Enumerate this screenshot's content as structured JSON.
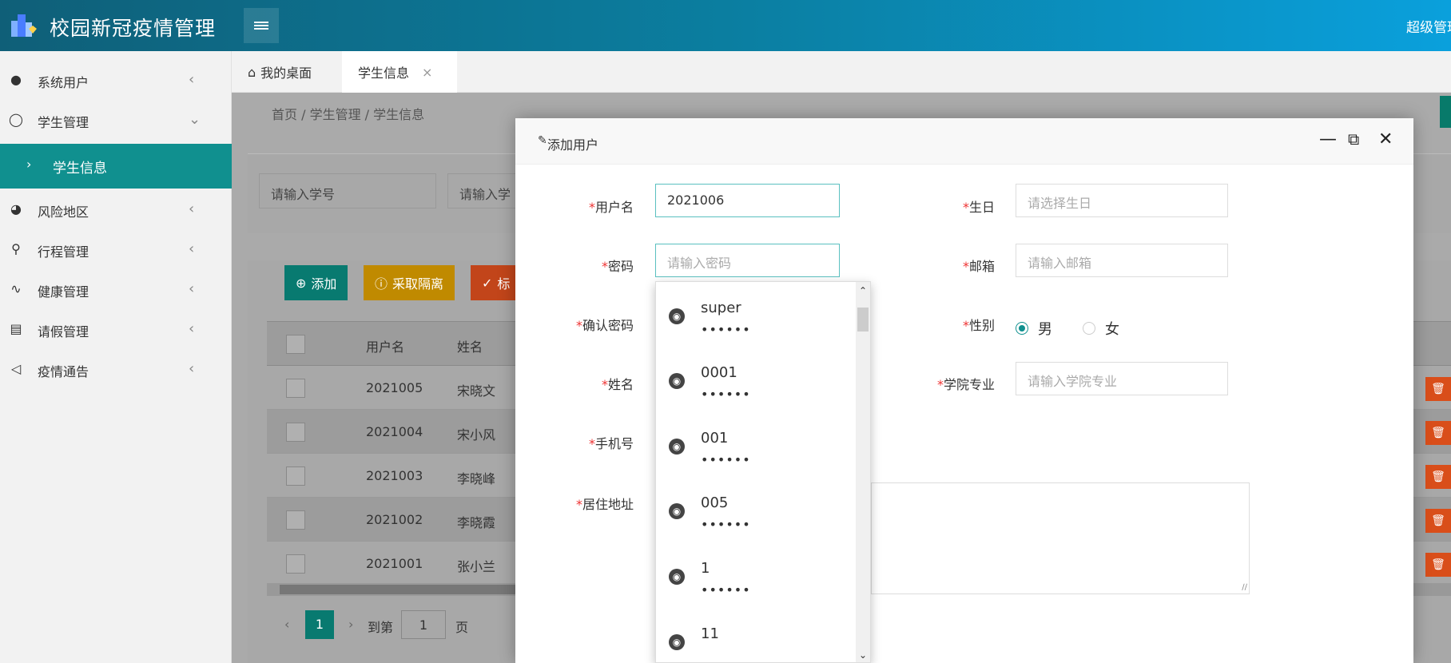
{
  "header": {
    "title": "校园新冠疫情管理",
    "admin_label": "超级管理员"
  },
  "sidebar": {
    "items": [
      {
        "label": "系统用户",
        "icon": "user-solid-icon"
      },
      {
        "label": "学生管理",
        "icon": "user-outline-icon"
      },
      {
        "label": "风险地区",
        "icon": "chart-pie-icon"
      },
      {
        "label": "行程管理",
        "icon": "location-icon"
      },
      {
        "label": "健康管理",
        "icon": "pulse-icon"
      },
      {
        "label": "请假管理",
        "icon": "document-icon"
      },
      {
        "label": "疫情通告",
        "icon": "speaker-icon"
      }
    ],
    "active_sub_item": "学生信息"
  },
  "tabs": [
    {
      "label": "我的桌面"
    },
    {
      "label": "学生信息",
      "close": "×"
    }
  ],
  "breadcrumb": {
    "text": "首页 / 学生管理 / 学生信息"
  },
  "search": {
    "student_no_placeholder": "请输入学号",
    "name_placeholder": "请输入学"
  },
  "toolbar": {
    "add_label": "添加",
    "isolate_label": "采取隔离",
    "mark_label": "标"
  },
  "table": {
    "headers": [
      "用户名",
      "姓名"
    ],
    "rows": [
      [
        "2021005",
        "宋晓文"
      ],
      [
        "2021004",
        "宋小风"
      ],
      [
        "2021003",
        "李晓峰"
      ],
      [
        "2021002",
        "李晓霞"
      ],
      [
        "2021001",
        "张小兰"
      ]
    ]
  },
  "pager": {
    "current": "1",
    "goto_label": "到第",
    "page_input": "1",
    "page_unit": "页"
  },
  "modal": {
    "title": "添加用户",
    "fields": {
      "username_label": "用户名",
      "username_value": "2021006",
      "password_label": "密码",
      "password_placeholder": "请输入密码",
      "confirm_label": "确认密码",
      "name_label": "姓名",
      "phone_label": "手机号",
      "address_label": "居住地址",
      "birthday_label": "生日",
      "birthday_placeholder": "请选择生日",
      "email_label": "邮箱",
      "email_placeholder": "请输入邮箱",
      "gender_label": "性别",
      "gender_male": "男",
      "gender_female": "女",
      "major_label": "学院专业",
      "major_placeholder": "请输入学院专业"
    },
    "required_mark": "*"
  },
  "autocomplete": {
    "items": [
      {
        "user": "super",
        "pass": "••••••"
      },
      {
        "user": "0001",
        "pass": "••••••"
      },
      {
        "user": "001",
        "pass": "••••••"
      },
      {
        "user": "005",
        "pass": "••••••"
      },
      {
        "user": "1",
        "pass": "••••••"
      },
      {
        "user": "11",
        "pass": ""
      }
    ]
  },
  "colors": {
    "teal": "#10908f",
    "orange": "#f0a000",
    "red": "#e8511f",
    "required": "#e33333"
  }
}
